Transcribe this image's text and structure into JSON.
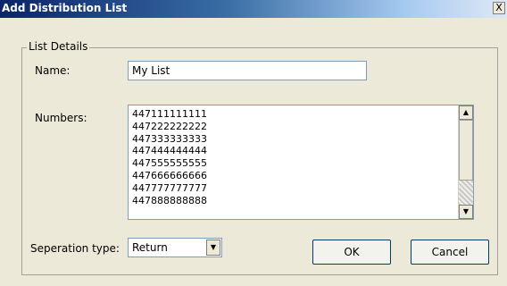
{
  "window": {
    "title": "Add Distribution List",
    "close_glyph": "X"
  },
  "group": {
    "title": "List Details"
  },
  "name_field": {
    "label": "Name:",
    "value": "My List"
  },
  "numbers_field": {
    "label": "Numbers:",
    "items": [
      "447111111111",
      "447222222222",
      "447333333333",
      "447444444444",
      "447555555555",
      "447666666666",
      "447777777777",
      "447888888888"
    ]
  },
  "separation": {
    "label": "Seperation type:",
    "value": "Return"
  },
  "buttons": {
    "ok": "OK",
    "cancel": "Cancel"
  },
  "icons": {
    "scroll_up": "scroll-up-arrow-icon",
    "scroll_down": "scroll-down-arrow-icon",
    "dropdown": "dropdown-arrow-icon"
  },
  "colors": {
    "title_bar": "#0a246a",
    "dialog_bg": "#ece9d8",
    "field_border": "#7f9db9"
  }
}
